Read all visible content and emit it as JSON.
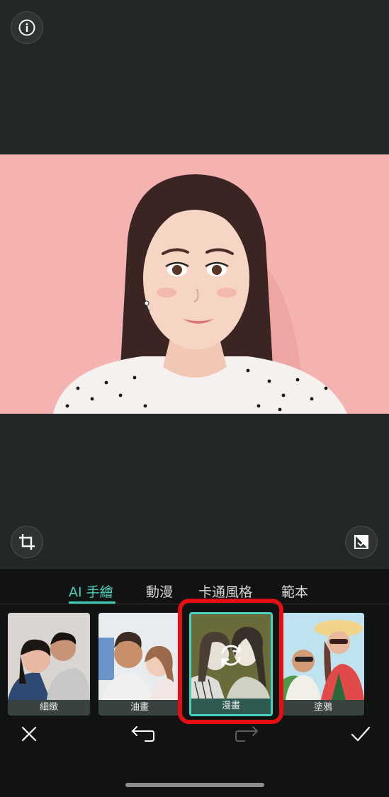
{
  "toolbar": {
    "info_icon": "info-icon",
    "crop_icon": "crop-icon",
    "compare_icon": "compare-icon"
  },
  "tabs": [
    {
      "label": "AI 手繪",
      "active": true
    },
    {
      "label": "動漫",
      "active": false
    },
    {
      "label": "卡通風格",
      "active": false
    },
    {
      "label": "範本",
      "active": false
    }
  ],
  "styles": [
    {
      "label": "細緻",
      "selected": false
    },
    {
      "label": "油畫",
      "selected": false
    },
    {
      "label": "漫畫",
      "selected": true
    },
    {
      "label": "塗鴉",
      "selected": false
    }
  ],
  "actions": {
    "cancel_icon": "close-icon",
    "undo_icon": "undo-icon",
    "redo_icon": "redo-icon",
    "apply_icon": "check-icon"
  },
  "colors": {
    "accent": "#45d3bf",
    "highlight": "#e50e12",
    "background_pink": "#f4b2b0"
  }
}
